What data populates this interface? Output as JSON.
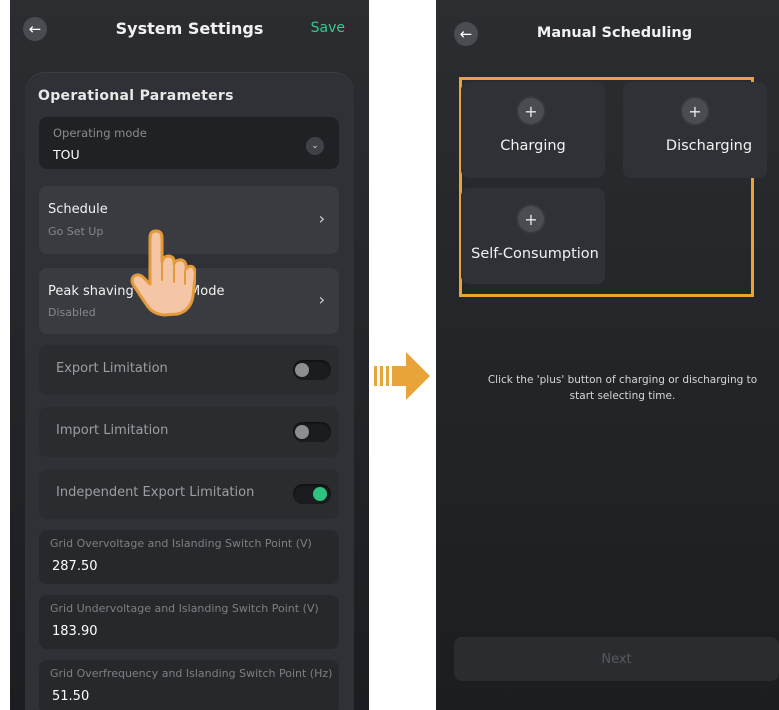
{
  "left": {
    "header": {
      "title": "System Settings",
      "save_label": "Save"
    },
    "section_title": "Operational Parameters",
    "operating_mode": {
      "label": "Operating mode",
      "value": "TOU"
    },
    "schedule": {
      "title": "Schedule",
      "subtitle": "Go Set Up"
    },
    "peak_shaving": {
      "title": "Peak shaving Control Mode",
      "subtitle": "Disabled"
    },
    "toggles": [
      {
        "label": "Export Limitation",
        "on": false
      },
      {
        "label": "Import Limitation",
        "on": false
      },
      {
        "label": "Independent Export Limitation",
        "on": true
      }
    ],
    "fields": [
      {
        "label": "Grid Overvoltage and Islanding Switch Point (V)",
        "value": "287.50"
      },
      {
        "label": "Grid Undervoltage and Islanding Switch Point (V)",
        "value": "183.90"
      },
      {
        "label": "Grid Overfrequency and Islanding Switch Point (Hz)",
        "value": "51.50"
      }
    ]
  },
  "right": {
    "header": {
      "title": "Manual Scheduling"
    },
    "modes": [
      {
        "label": "Charging"
      },
      {
        "label": "Discharging"
      },
      {
        "label": "Self-Consumption"
      }
    ],
    "hint": "Click the 'plus' button of charging or discharging to start selecting time.",
    "next_label": "Next"
  },
  "colors": {
    "accent_green": "#2ecc8f",
    "highlight_orange": "#e8a43a",
    "toggle_on": "#2ec27e",
    "background": "#2b2d31"
  },
  "icons": {
    "back": "arrow-left-icon",
    "chevron": "chevron-right-icon",
    "dropdown": "chevron-down-icon",
    "plus": "plus-icon",
    "pointer": "hand-pointer-icon",
    "transition": "arrow-right-icon"
  }
}
